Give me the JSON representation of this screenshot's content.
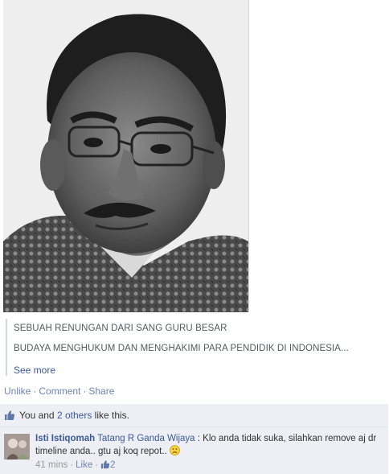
{
  "post": {
    "quote_line1": "SEBUAH RENUNGAN DARI SANG GURU BESAR",
    "quote_line2": "BUDAYA MENGHUKUM DAN MENGHAKIMI PARA PENDIDIK DI INDONESIA...",
    "see_more": "See more"
  },
  "actions": {
    "unlike": "Unlike",
    "comment": "Comment",
    "share": "Share",
    "separator": "·"
  },
  "likes": {
    "prefix": "You and ",
    "others": "2 others",
    "suffix": " like this."
  },
  "comment": {
    "author": "Isti Istiqomah",
    "tag": "Tatang R Ganda Wijaya",
    "text": " : Klo anda tidak suka, silahkan remove aj dr timeline anda.. gtu aj koq repot.. ",
    "time": "41 mins",
    "like_label": "Like",
    "like_count": "2",
    "separator": "·"
  },
  "icons": {
    "thumb": "thumbs-up-icon",
    "emoji": "frown-face-icon"
  },
  "colors": {
    "link": "#3b5998",
    "action_link": "#6d84b4",
    "ufi_bg": "#edeff4"
  }
}
